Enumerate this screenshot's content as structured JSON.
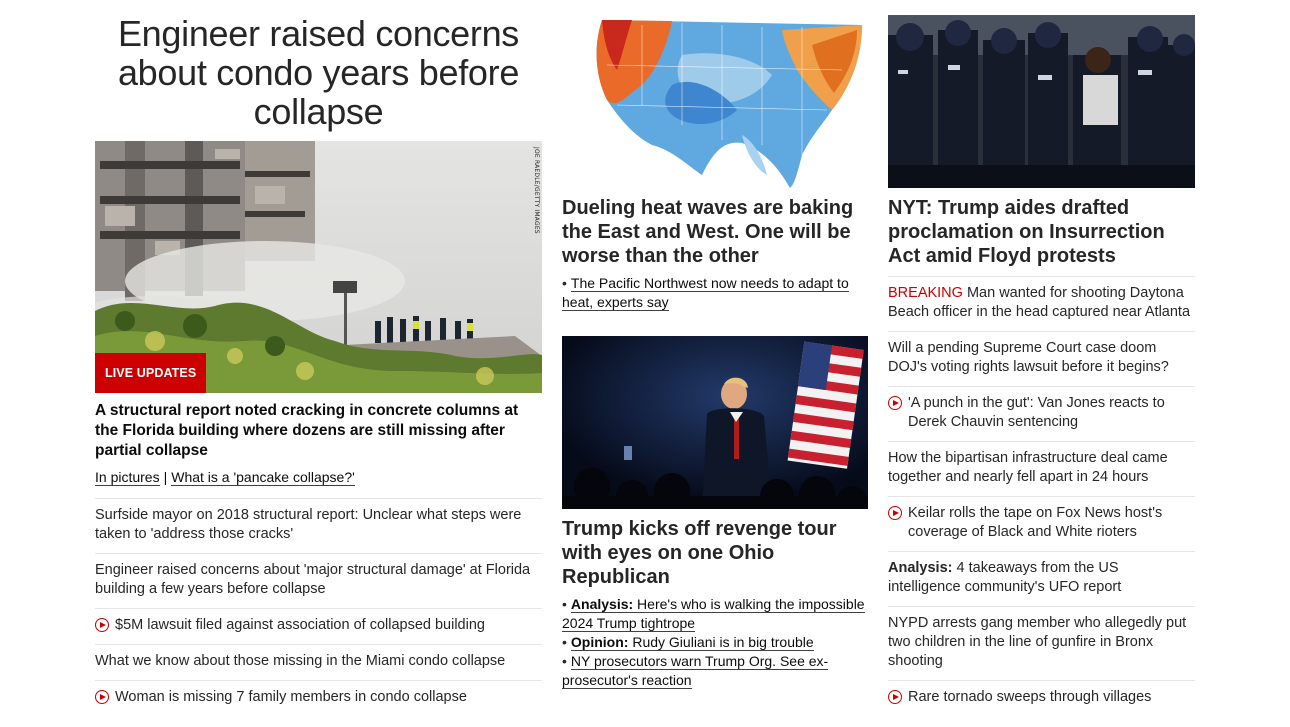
{
  "lead": {
    "headline": "Engineer raised concerns about condo years before collapse",
    "photo_credit": "JOE RAEDLE/GETTY IMAGES",
    "badge": "LIVE UPDATES",
    "title": "A structural report noted cracking in concrete columns at the Florida building where dozens are still missing after partial collapse",
    "links": [
      "In pictures",
      "What is a 'pancake collapse?'"
    ],
    "list": [
      {
        "text": "Surfside mayor on 2018 structural report: Unclear what steps were taken to 'address those cracks'",
        "video": false
      },
      {
        "text": "Engineer raised concerns about 'major structural damage' at Florida building a few years before collapse",
        "video": false
      },
      {
        "text": "$5M lawsuit filed against association of collapsed building",
        "video": true
      },
      {
        "text": "What we know about those missing in the Miami condo collapse",
        "video": false
      },
      {
        "text": "Woman is missing 7 family members in condo collapse",
        "video": true
      }
    ]
  },
  "heat": {
    "title": "Dueling heat waves are baking the East and West. One will be worse than the other",
    "bullet": "The Pacific Northwest now needs to adapt to heat, experts say"
  },
  "trump": {
    "title": "Trump kicks off revenge tour with eyes on one Ohio Republican",
    "bullets": [
      {
        "label": "Analysis:",
        "text": "Here's who is walking the impossible 2024 Trump tightrope"
      },
      {
        "label": "Opinion:",
        "text": "Rudy Giuliani is in big trouble"
      },
      {
        "label": "",
        "text": "NY prosecutors warn Trump Org. See ex-prosecutor's reaction"
      }
    ]
  },
  "nyt": {
    "title": "NYT: Trump aides drafted proclamation on Insurrection Act amid Floyd protests",
    "list": [
      {
        "prefix": "BREAKING",
        "text": "Man wanted for shooting Daytona Beach officer in the head captured near Atlanta",
        "video": false
      },
      {
        "prefix": "",
        "text": "Will a pending Supreme Court case doom DOJ's voting rights lawsuit before it begins?",
        "video": false
      },
      {
        "prefix": "",
        "text": "'A punch in the gut': Van Jones reacts to Derek Chauvin sentencing",
        "video": true
      },
      {
        "prefix": "",
        "text": "How the bipartisan infrastructure deal came together and nearly fell apart in 24 hours",
        "video": false
      },
      {
        "prefix": "",
        "text": "Keilar rolls the tape on Fox News host's coverage of Black and White rioters",
        "video": true
      },
      {
        "prefix": "Analysis:",
        "text": "4 takeaways from the US intelligence community's UFO report",
        "video": false
      },
      {
        "prefix": "",
        "text": "NYPD arrests gang member who allegedly put two children in the line of gunfire in Bronx shooting",
        "video": false
      },
      {
        "prefix": "",
        "text": "Rare tornado sweeps through villages",
        "video": true
      }
    ]
  },
  "colors": {
    "accent": "#cc0000",
    "text": "#262626",
    "divider": "#e6e6e6"
  }
}
